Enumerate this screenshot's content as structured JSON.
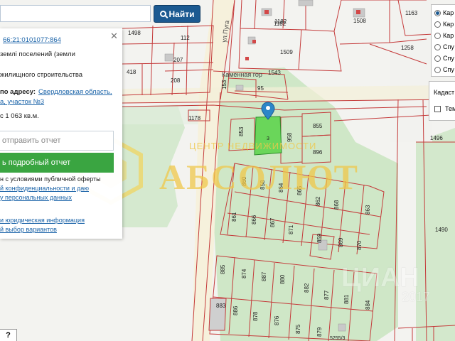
{
  "search": {
    "placeholder": "",
    "button_label": "Найти"
  },
  "info": {
    "cadastral_number": "66:21:0101077:864",
    "category": "землі поселений (земли",
    "use": "жилищного строительства",
    "address_label": "по адресу:",
    "address_part1": "Свердловская область,",
    "address_part2": "а, участок №3",
    "area": "с 1 063 кв.м.",
    "send_report_placeholder": "отправить отчет",
    "detailed_report_button": "ь подробный отчет",
    "consent_line1": "н с условиями публичной оферты",
    "consent_line2": "й конфиденциальности и даю",
    "consent_line3": "у персональных данных",
    "legal_info_link": "и юридическая информация",
    "choice_link": "й выбор вариантов"
  },
  "layers": {
    "options": [
      "Кар",
      "Кар",
      "Кар",
      "Спу",
      "Спу",
      "Спу"
    ],
    "selected_index": 0,
    "cadastre_label": "Кадаст",
    "cadastre_checkbox_label": "Тем"
  },
  "map": {
    "street": "ул.Пуга",
    "street2": "Каменная гор",
    "selected_plot": "3",
    "plots": [
      "1498",
      "112",
      "1182",
      "1508",
      "1163",
      "418",
      "207",
      "1509",
      "1258",
      "208",
      "1543",
      "95",
      "153",
      "1178",
      "853",
      "855",
      "958",
      "896",
      "1496",
      "860",
      "858",
      "864",
      "865",
      "862",
      "868",
      "863",
      "861",
      "866",
      "867",
      "871",
      "859",
      "869",
      "870",
      "1490",
      "885",
      "874",
      "887",
      "880",
      "882",
      "877",
      "881",
      "884",
      "883",
      "886",
      "878",
      "876",
      "875",
      "879",
      "1182"
    ]
  },
  "watermark": {
    "title": "АБСОЛЮТ",
    "subtitle": "ЦЕНТР НЕДВИЖИМОСТИ",
    "site": "ЦИАН",
    "year": "2017"
  },
  "help": {
    "label": "?"
  },
  "scale_label": "5255/3"
}
